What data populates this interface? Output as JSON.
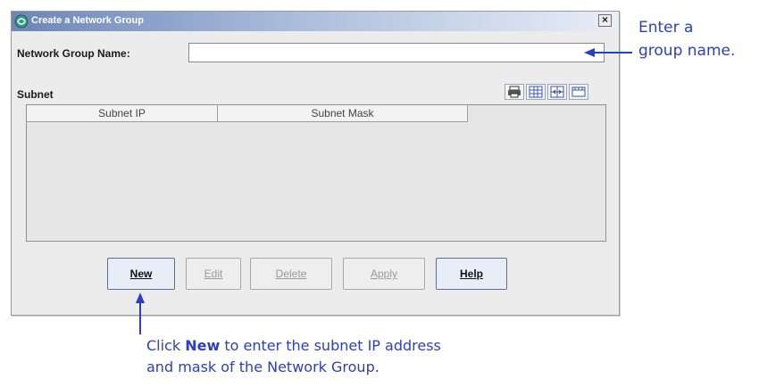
{
  "dialog": {
    "title": "Create a Network Group",
    "close_label": "×",
    "network_group_name_label": "Network Group Name:",
    "network_group_name_value": "",
    "subnet_label": "Subnet",
    "table": {
      "columns": [
        "Subnet IP",
        "Subnet Mask"
      ],
      "rows": []
    },
    "toolbar_icons": [
      "print-icon",
      "table-view-icon",
      "column-settings-icon",
      "export-icon"
    ],
    "buttons": [
      {
        "label": "New",
        "mnemonic_index": 0,
        "enabled": true
      },
      {
        "label": "Edit",
        "mnemonic_index": 0,
        "enabled": false
      },
      {
        "label": "Delete",
        "mnemonic_index": 0,
        "enabled": false
      },
      {
        "label": "Apply",
        "mnemonic_index": 0,
        "enabled": false
      },
      {
        "label": "Help",
        "mnemonic_index": 0,
        "enabled": true
      }
    ]
  },
  "annotations": {
    "top_line1": "Enter a",
    "top_line2": "group name.",
    "bottom_pre": "Click ",
    "bottom_strong": "New",
    "bottom_post": " to enter the subnet IP address",
    "bottom_line2": "and mask of the Network Group."
  },
  "colors": {
    "annotation": "#2b3fc4",
    "titlebar_start": "#6b86b8"
  }
}
